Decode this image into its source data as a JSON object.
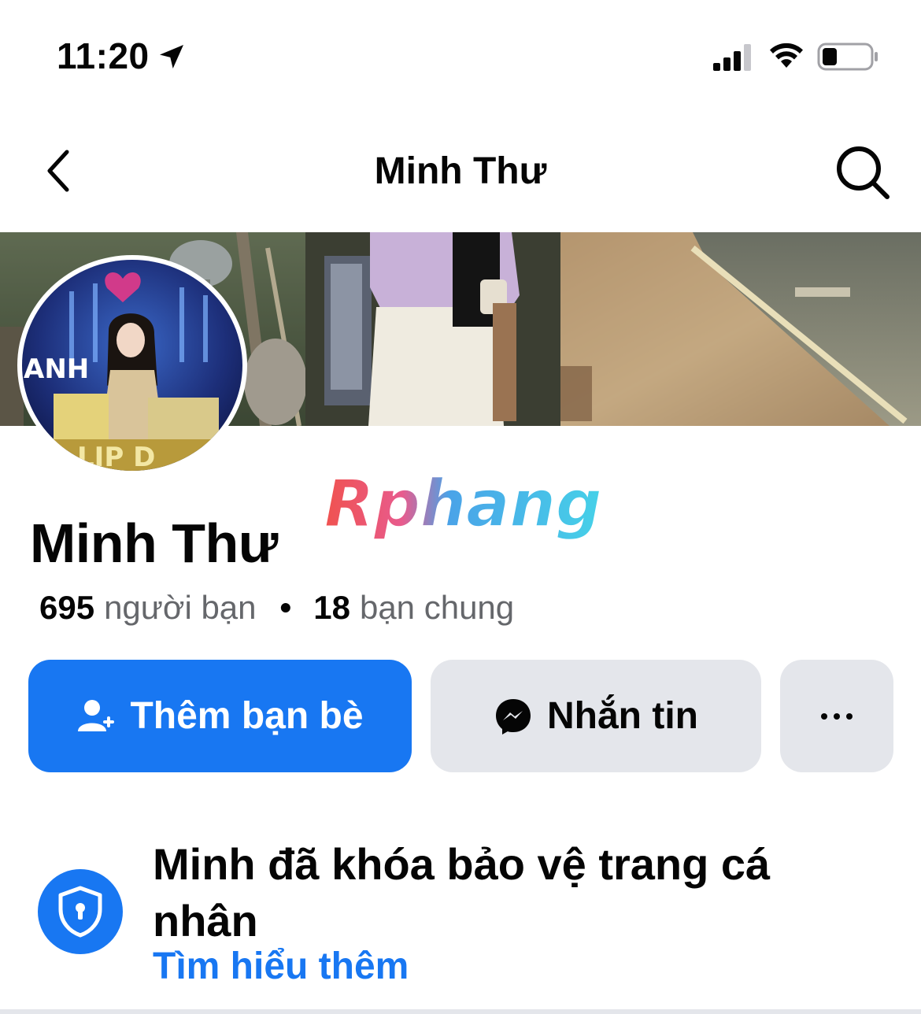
{
  "status_bar": {
    "time": "11:20",
    "icons": [
      "location-arrow-icon",
      "cellular-signal-icon",
      "wifi-icon",
      "battery-icon"
    ]
  },
  "nav": {
    "title": "Minh Thư",
    "back_icon": "chevron-left-icon",
    "search_icon": "search-icon"
  },
  "profile": {
    "name": "Minh Thư",
    "friends_count": "695",
    "friends_label": "người bạn",
    "separator": "•",
    "mutual_count": "18",
    "mutual_label": "bạn chung"
  },
  "watermark": {
    "text": "Rphang"
  },
  "actions": {
    "add_friend_label": "Thêm bạn bè",
    "message_label": "Nhắn tin",
    "more_label": "···"
  },
  "lock_notice": {
    "title": "Minh đã khóa bảo vệ trang cá nhân",
    "link": "Tìm hiểu thêm",
    "icon": "shield-lock-icon"
  },
  "colors": {
    "primary": "#1877f2",
    "secondary_button": "#e4e6eb",
    "text": "#050505",
    "muted_text": "#65676b"
  }
}
